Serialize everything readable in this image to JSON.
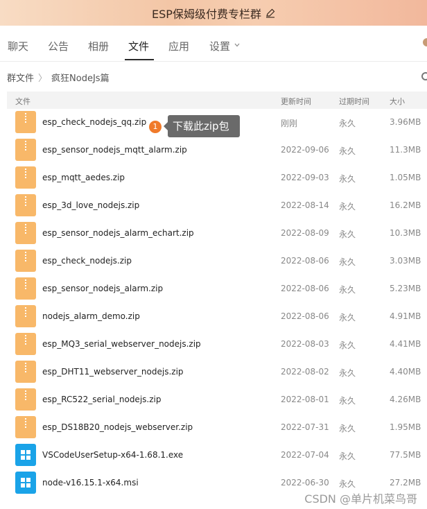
{
  "window": {
    "title": "ESP保姆级付费专栏群"
  },
  "tabs": [
    "聊天",
    "公告",
    "相册",
    "文件",
    "应用",
    "设置"
  ],
  "active_tab": "文件",
  "breadcrumb": {
    "root": "群文件",
    "sep": "〉",
    "current": "疯狂NodeJs篇"
  },
  "columns": {
    "name": "文件",
    "updated": "更新时间",
    "expiry": "过期时间",
    "size": "大小"
  },
  "files": [
    {
      "name": "esp_check_nodejs_qq.zip",
      "updated": "刚刚",
      "expiry": "永久",
      "size": "3.96MB",
      "type": "zip"
    },
    {
      "name": "esp_sensor_nodejs_mqtt_alarm.zip",
      "updated": "2022-09-06",
      "expiry": "永久",
      "size": "11.3MB",
      "type": "zip"
    },
    {
      "name": "esp_mqtt_aedes.zip",
      "updated": "2022-09-03",
      "expiry": "永久",
      "size": "1.05MB",
      "type": "zip"
    },
    {
      "name": "esp_3d_love_nodejs.zip",
      "updated": "2022-08-14",
      "expiry": "永久",
      "size": "16.2MB",
      "type": "zip"
    },
    {
      "name": "esp_sensor_nodejs_alarm_echart.zip",
      "updated": "2022-08-09",
      "expiry": "永久",
      "size": "10.3MB",
      "type": "zip"
    },
    {
      "name": "esp_check_nodejs.zip",
      "updated": "2022-08-06",
      "expiry": "永久",
      "size": "3.03MB",
      "type": "zip"
    },
    {
      "name": "esp_sensor_nodejs_alarm.zip",
      "updated": "2022-08-06",
      "expiry": "永久",
      "size": "5.23MB",
      "type": "zip"
    },
    {
      "name": "nodejs_alarm_demo.zip",
      "updated": "2022-08-06",
      "expiry": "永久",
      "size": "4.91MB",
      "type": "zip"
    },
    {
      "name": "esp_MQ3_serial_webserver_nodejs.zip",
      "updated": "2022-08-03",
      "expiry": "永久",
      "size": "4.41MB",
      "type": "zip"
    },
    {
      "name": "esp_DHT11_webserver_nodejs.zip",
      "updated": "2022-08-02",
      "expiry": "永久",
      "size": "4.40MB",
      "type": "zip"
    },
    {
      "name": "esp_RC522_serial_nodejs.zip",
      "updated": "2022-08-01",
      "expiry": "永久",
      "size": "4.26MB",
      "type": "zip"
    },
    {
      "name": "esp_DS18B20_nodejs_webserver.zip",
      "updated": "2022-07-31",
      "expiry": "永久",
      "size": "1.95MB",
      "type": "zip"
    },
    {
      "name": "VSCodeUserSetup-x64-1.68.1.exe",
      "updated": "2022-07-04",
      "expiry": "永久",
      "size": "77.5MB",
      "type": "exe"
    },
    {
      "name": "node-v16.15.1-x64.msi",
      "updated": "2022-06-30",
      "expiry": "永久",
      "size": "27.2MB",
      "type": "exe"
    }
  ],
  "callout": {
    "number": "1",
    "text": "下载此zip包"
  },
  "watermark": "CSDN @单片机菜鸟哥",
  "colors": {
    "zip_icon": "#f8b869",
    "installer_icon": "#1aa3e8",
    "callout_badge": "#f07a2a"
  }
}
